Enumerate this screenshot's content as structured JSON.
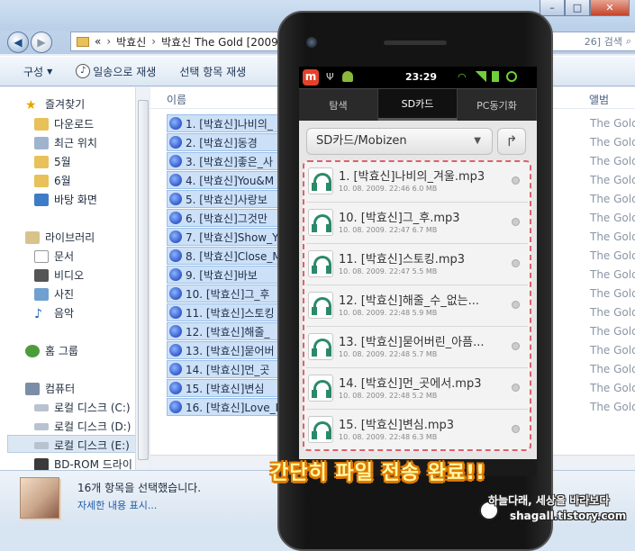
{
  "window": {
    "address_parts": [
      "«",
      "박효신",
      "박효신 The Gold [2009.0"
    ],
    "search_placeholder": "26] 검색",
    "min": "–",
    "max": "□",
    "close": "✕"
  },
  "toolbar": {
    "organize": "구성",
    "play_all": "일송으로 재생",
    "play_selected": "선택 항목 재생"
  },
  "nav": {
    "favorites": "즐겨찾기",
    "items": [
      "다운로드",
      "최근 위치",
      "5월",
      "6월",
      "바탕 화면"
    ],
    "libraries": "라이브러리",
    "lib_items": [
      "문서",
      "비디오",
      "사진",
      "음악"
    ],
    "homegroup": "홈 그룹",
    "computer": "컴퓨터",
    "drives": [
      "로컬 디스크 (C:)",
      "로컬 디스크 (D:)",
      "로컬 디스크 (E:)",
      "BD-ROM 드라이"
    ]
  },
  "list": {
    "col_name": "이름",
    "col_album": "앨범",
    "album_value": "The Gold",
    "files": [
      "1. [박효신]나비의_",
      "2. [박효신]동경",
      "3. [박효신]좋은_사",
      "4. [박효신]You&M",
      "5. [박효신]사랑보",
      "6. [박효신]그것만",
      "7. [박효신]Show_Y",
      "8. [박효신]Close_M",
      "9. [박효신]바보",
      "10. [박효신]그_후",
      "11. [박효신]스토킹",
      "12. [박효신]해줄_",
      "13. [박효신]묻어버",
      "14. [박효신]먼_곳",
      "15. [박효신]변심",
      "16. [박효신]Love_Is"
    ]
  },
  "status": {
    "line1": "16개 항목을 선택했습니다.",
    "line2": "자세한 내용 표시..."
  },
  "phone": {
    "time": "23:29",
    "app_icon": "m",
    "tabs": [
      "탐색",
      "SD카드",
      "PC동기화"
    ],
    "path": "SD카드/Mobizen",
    "files": [
      {
        "name": "1. [박효신]나비의_겨울.mp3",
        "meta": "10. 08. 2009. 22:46  6.0 MB"
      },
      {
        "name": "10. [박효신]그_후.mp3",
        "meta": "10. 08. 2009. 22:47  6.7 MB"
      },
      {
        "name": "11. [박효신]스토킹.mp3",
        "meta": "10. 08. 2009. 22:47  5.5 MB"
      },
      {
        "name": "12. [박효신]해줄_수_없는...",
        "meta": "10. 08. 2009. 22:48  5.9 MB"
      },
      {
        "name": "13. [박효신]묻어버린_아픔...",
        "meta": "10. 08. 2009. 22:48  5.7 MB"
      },
      {
        "name": "14. [박효신]먼_곳에서.mp3",
        "meta": "10. 08. 2009. 22:48  5.2 MB"
      },
      {
        "name": "15. [박효신]변심.mp3",
        "meta": "10. 08. 2009. 22:48  6.3 MB"
      }
    ]
  },
  "overlay": {
    "caption": "간단히 파일 전송 완료!!",
    "watermark1": "하늘다래, 세상을 바라보다",
    "watermark2": "shagall.tistory.com"
  },
  "colors": {
    "accent": "#1e5aa8",
    "dashed_border": "#e0606a",
    "headphone": "#2a8a68"
  }
}
